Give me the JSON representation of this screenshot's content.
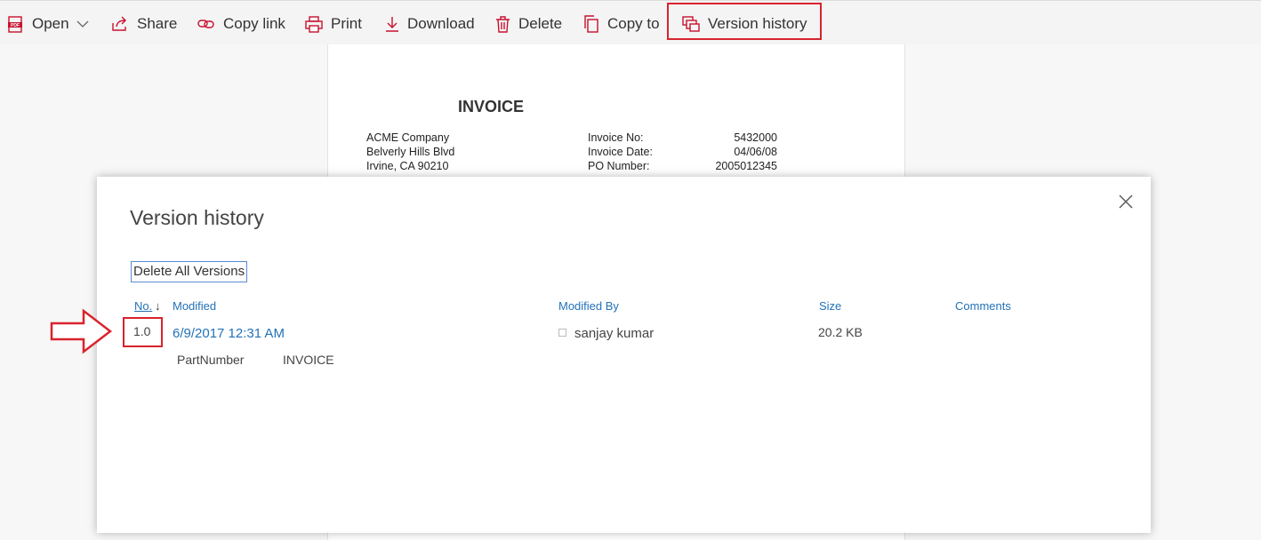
{
  "toolbar": {
    "open_label": "Open",
    "share_label": "Share",
    "copy_link_label": "Copy link",
    "print_label": "Print",
    "download_label": "Download",
    "delete_label": "Delete",
    "copy_to_label": "Copy to",
    "version_history_label": "Version history"
  },
  "document": {
    "title": "INVOICE",
    "company": "ACME Company",
    "street": "Belverly Hills Blvd",
    "city": "Irvine, CA 90210",
    "invoice_no_label": "Invoice No:",
    "invoice_no": "5432000",
    "invoice_date_label": "Invoice Date:",
    "invoice_date": "04/06/08",
    "po_number_label": "PO Number:",
    "po_number": "2005012345"
  },
  "dialog": {
    "title": "Version history",
    "delete_all_label": "Delete All Versions",
    "columns": {
      "no": "No.",
      "modified": "Modified",
      "modified_by": "Modified By",
      "size": "Size",
      "comments": "Comments"
    },
    "rows": [
      {
        "no": "1.0",
        "modified": "6/9/2017 12:31 AM",
        "modified_by": "sanjay kumar",
        "size": "20.2 KB",
        "meta_key": "PartNumber",
        "meta_value": "INVOICE"
      }
    ]
  },
  "colors": {
    "accent": "#2272b8",
    "highlight": "#d9232d"
  }
}
